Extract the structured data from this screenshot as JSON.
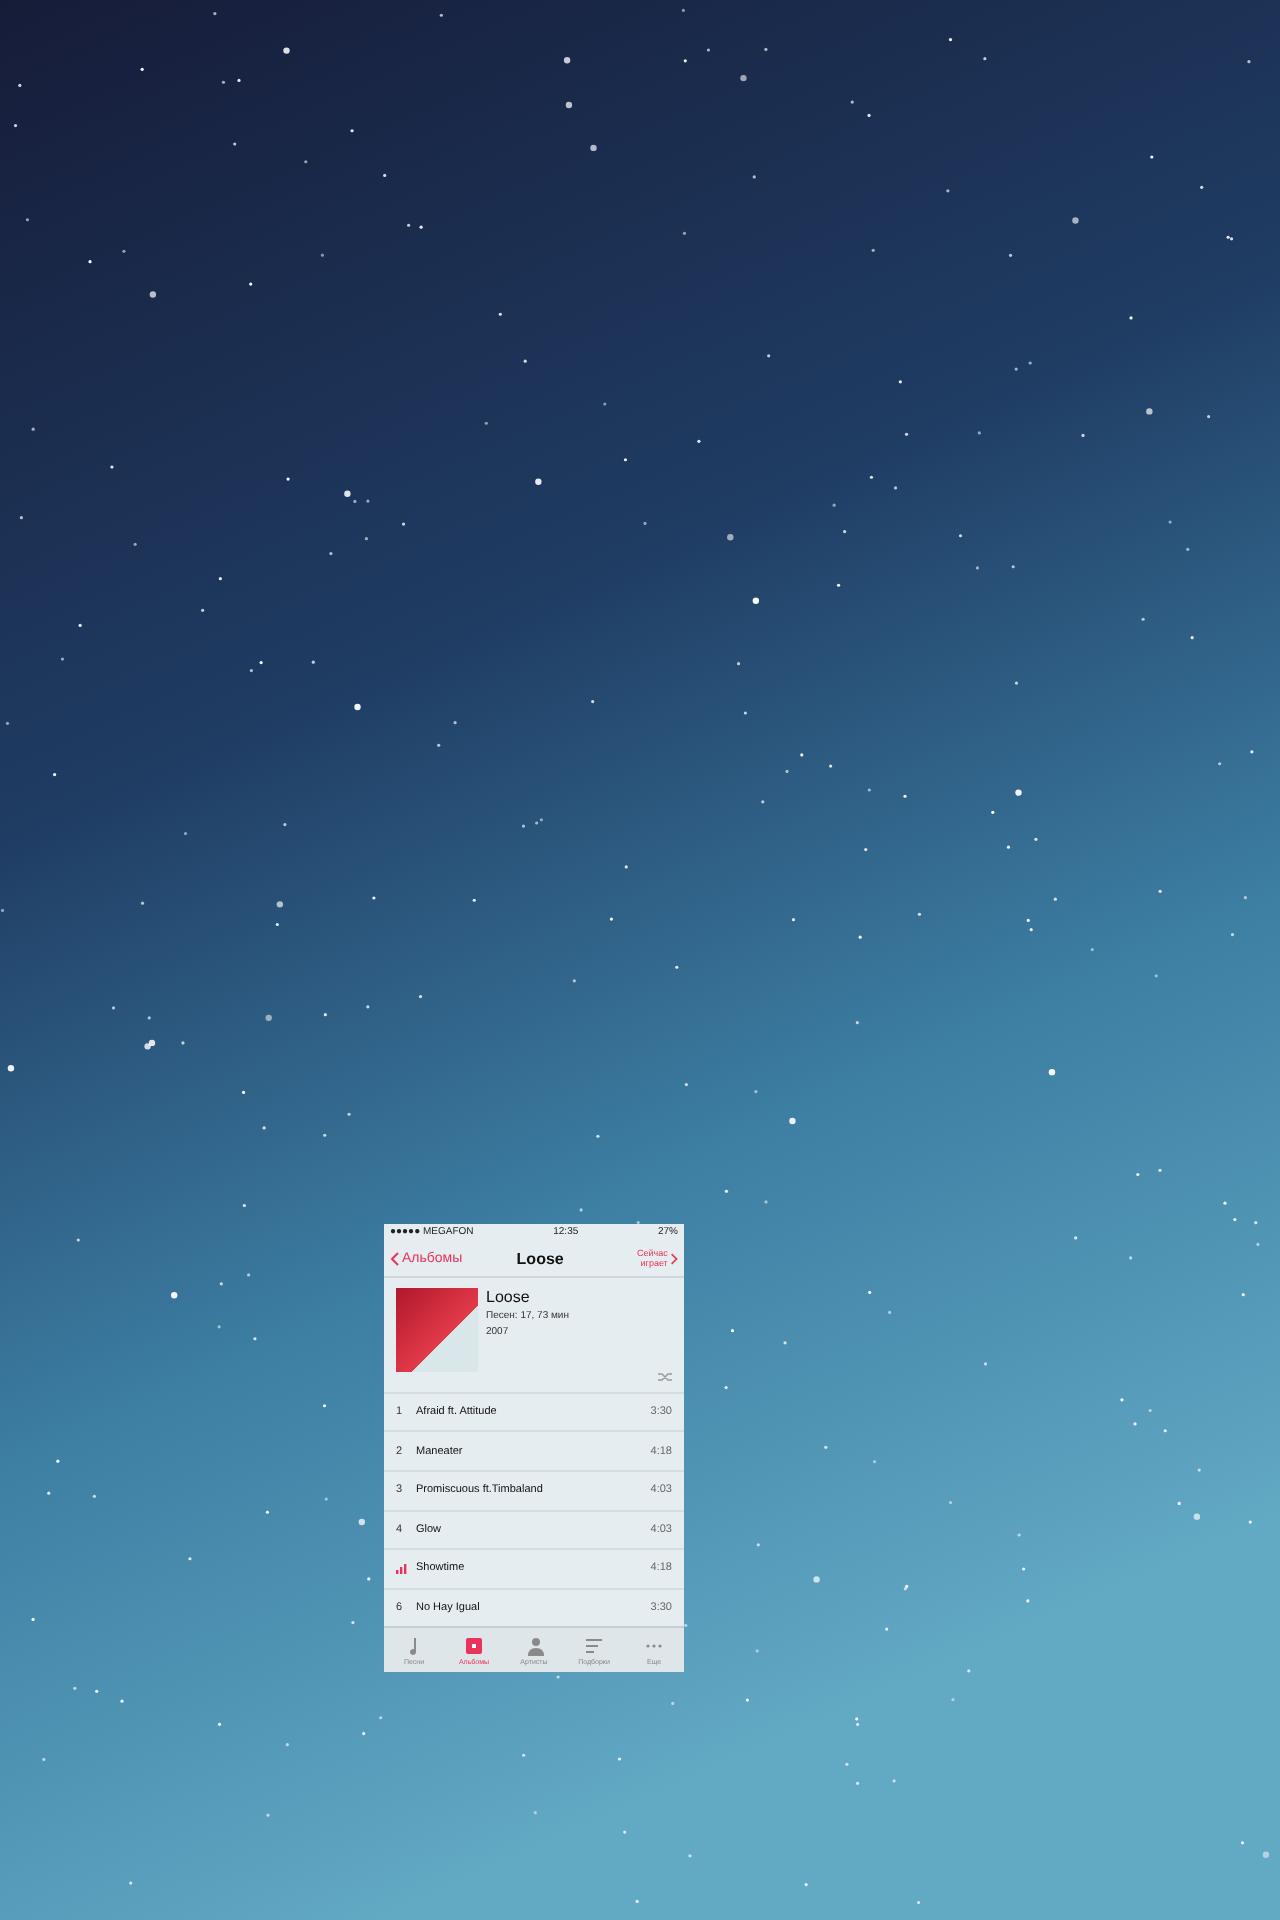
{
  "status_bar": {
    "carrier": "●●●●● MEGAFON",
    "time": "12:35",
    "battery": "27%"
  },
  "nav": {
    "back": "Альбомы",
    "title": "Loose",
    "now_playing": "Сейчас играет"
  },
  "album": {
    "title": "Loose",
    "info": "Песен: 17, 73 мин",
    "year": "2007"
  },
  "tracks": [
    {
      "kind": "number",
      "number": "1",
      "title": "Afraid ft. Attitude",
      "duration": "3:30"
    },
    {
      "kind": "number",
      "number": "2",
      "title": "Maneater",
      "duration": "4:18"
    },
    {
      "kind": "number",
      "number": "3",
      "title": "Promiscuous ft.Timbaland",
      "duration": "4:03"
    },
    {
      "kind": "number",
      "number": "4",
      "title": "Glow",
      "duration": "4:03"
    },
    {
      "kind": "playing",
      "title": "Showtime",
      "duration": "4:18"
    },
    {
      "kind": "number",
      "number": "6",
      "title": "No Hay Igual",
      "duration": "3:30"
    }
  ],
  "tab_bar": [
    {
      "kind": "songs",
      "label": "Песни",
      "selected": false
    },
    {
      "kind": "albums",
      "label": "Альбомы",
      "selected": true
    },
    {
      "kind": "artists",
      "label": "Артисты",
      "selected": false
    },
    {
      "kind": "playlists",
      "label": "Подборки",
      "selected": false
    },
    {
      "kind": "more",
      "label": "Еще",
      "selected": false
    }
  ]
}
